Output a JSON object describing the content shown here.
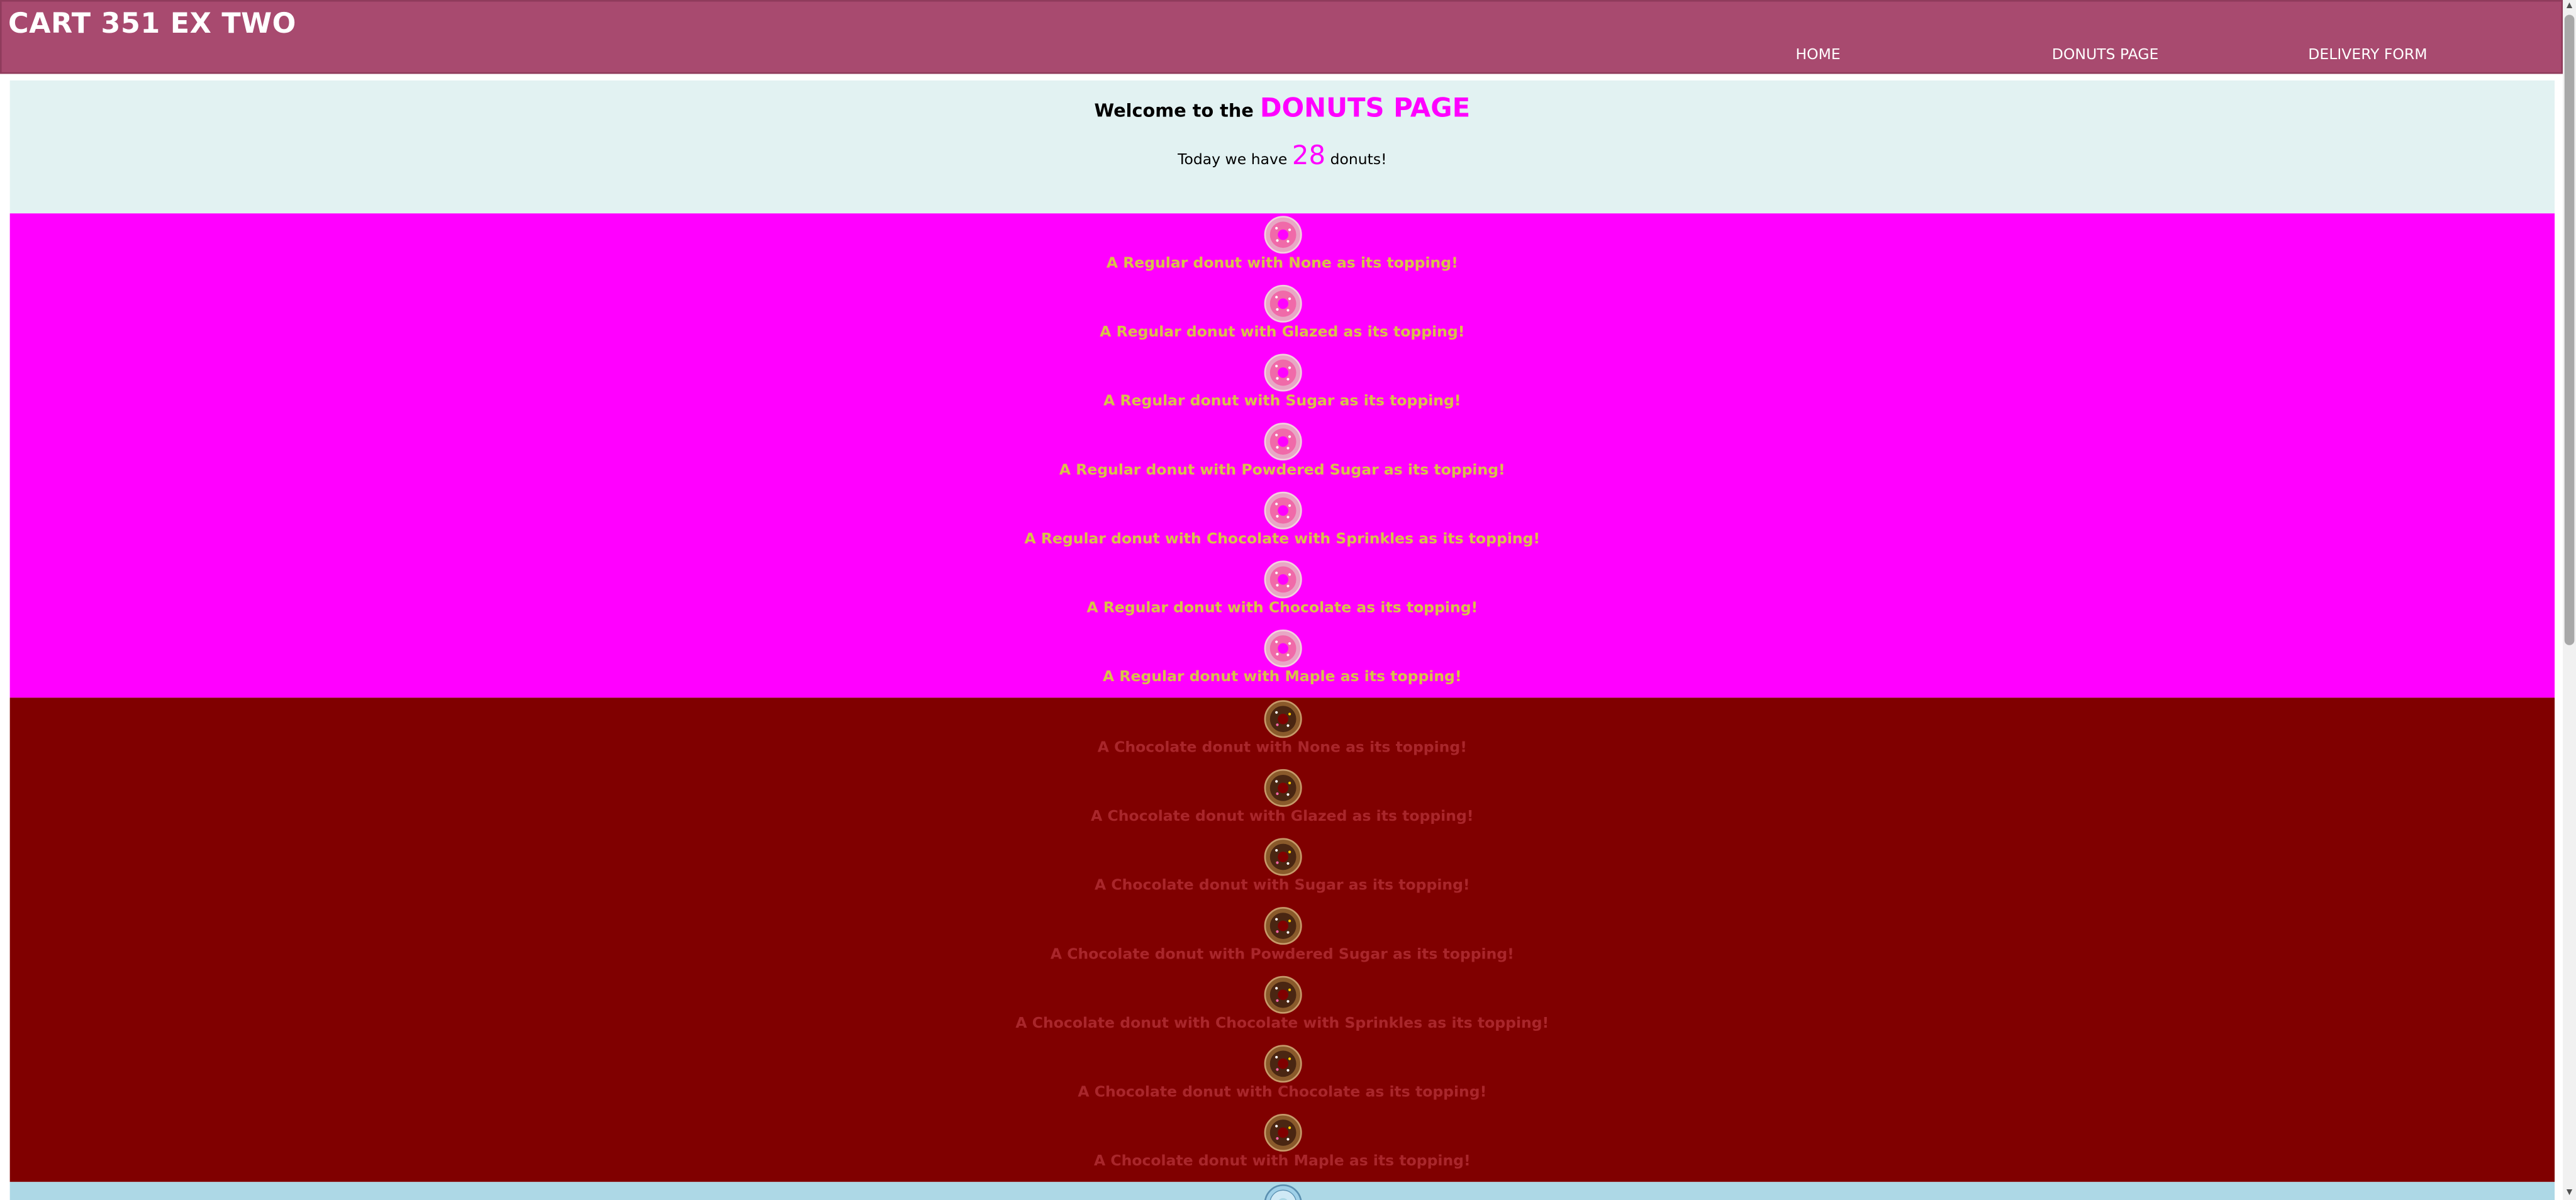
{
  "header": {
    "site_title": "CART 351 EX TWO",
    "nav": [
      "HOME",
      "DONUTS PAGE",
      "DELIVERY FORM"
    ]
  },
  "welcome": {
    "prefix": "Welcome to the",
    "page_name": "DONUTS PAGE",
    "count_prefix": "Today we have",
    "count": "28",
    "count_suffix": "donuts!"
  },
  "regular_section": {
    "color": "#ff00ff",
    "icon": "pink-donut-icon",
    "items": [
      "A Regular donut with None as its topping!",
      "A Regular donut with Glazed as its topping!",
      "A Regular donut with Sugar as its topping!",
      "A Regular donut with Powdered Sugar as its topping!",
      "A Regular donut with Chocolate with Sprinkles as its topping!",
      "A Regular donut with Chocolate as its topping!",
      "A Regular donut with Maple as its topping!"
    ]
  },
  "chocolate_section": {
    "color": "#800000",
    "icon": "chocolate-donut-icon",
    "items": [
      "A Chocolate donut with None as its topping!",
      "A Chocolate donut with Glazed as its topping!",
      "A Chocolate donut with Sugar as its topping!",
      "A Chocolate donut with Powdered Sugar as its topping!",
      "A Chocolate donut with Chocolate with Sprinkles as its topping!",
      "A Chocolate donut with Chocolate as its topping!",
      "A Chocolate donut with Maple as its topping!"
    ]
  },
  "next_section": {
    "color": "#add8e6",
    "icon": "blue-donut-icon"
  },
  "colors": {
    "header": "#a84a6f",
    "welcome_bg": "#e2f2f2",
    "accent": "#ff00ff"
  }
}
